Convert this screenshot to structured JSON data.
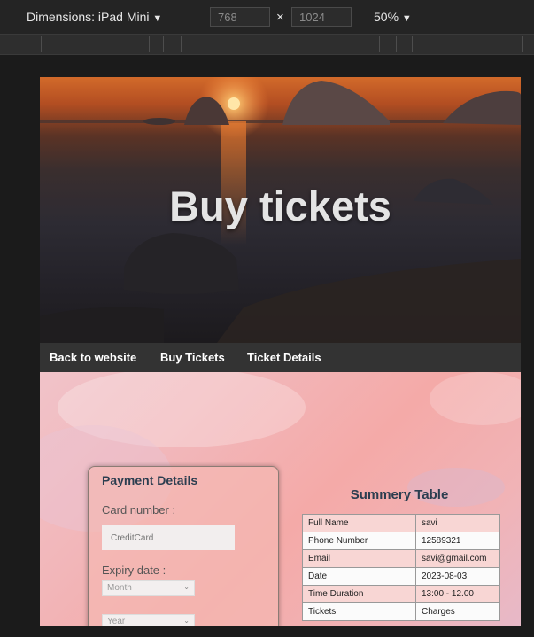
{
  "toolbar": {
    "dimensions_label": "Dimensions: iPad Mini",
    "width_value": "768",
    "height_value": "1024",
    "times": "×",
    "zoom": "50%",
    "caret": "▼"
  },
  "hero": {
    "title": "Buy tickets"
  },
  "nav": {
    "items": [
      "Back to website",
      "Buy Tickets",
      "Ticket Details"
    ]
  },
  "payment": {
    "title": "Payment Details",
    "card_label": "Card number :",
    "card_placeholder": "CreditCard",
    "expiry_label": "Expiry date :",
    "month": "Month",
    "year": "Year",
    "chevron": "⌄"
  },
  "summary": {
    "title": "Summery Table",
    "rows": [
      [
        "Full Name",
        "savi"
      ],
      [
        "Phone Number",
        "12589321"
      ],
      [
        "Email",
        "savi@gmail.com"
      ],
      [
        "Date",
        "2023-08-03"
      ],
      [
        "Time Duration",
        "13:00 - 12.00"
      ],
      [
        "Tickets",
        "Charges"
      ]
    ]
  },
  "colors": {
    "nav_bg": "#333333",
    "heading": "#2c3e50",
    "row_pink": "#f8d6d4"
  }
}
